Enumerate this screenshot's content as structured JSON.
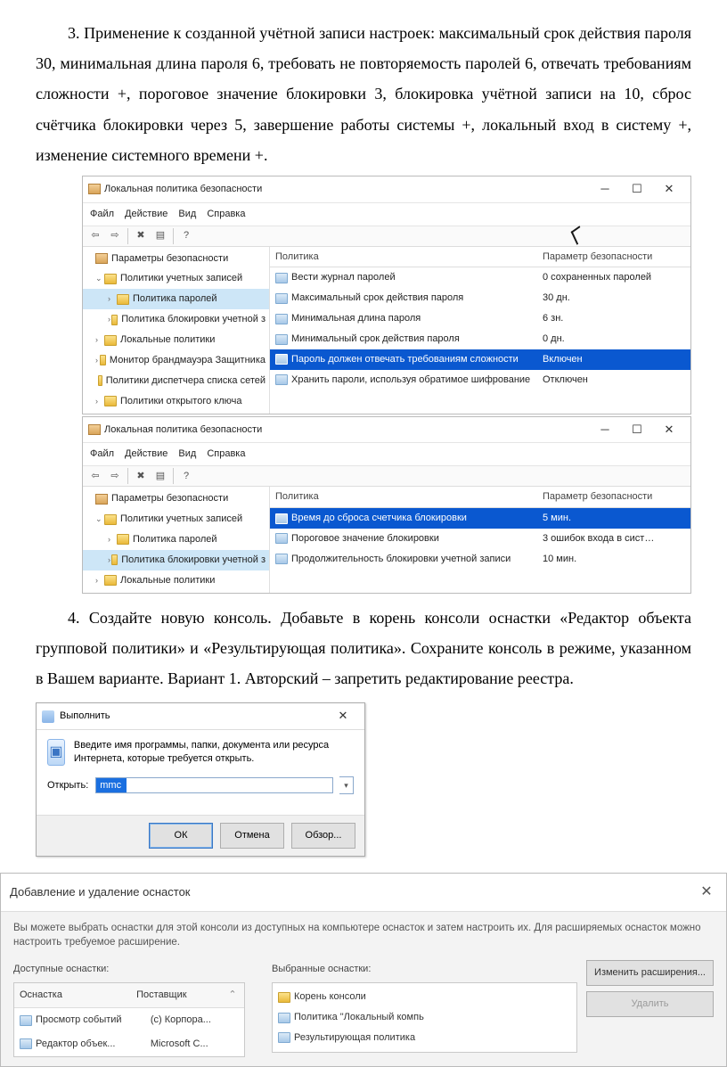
{
  "para3": "3. Применение к созданной учётной записи настроек: максимальный срок действия пароля 30, минимальная длина пароля 6, требовать не повторяемость паролей 6, отвечать требованиям сложности +, пороговое значение блокировки 3, блокировка учётной записи на 10, сброс счётчика блокировки через 5, завершение работы системы +, локальный вход в систему +, изменение системного времени +.",
  "para4": "4. Создайте новую консоль. Добавьте в корень консоли оснастки «Редактор объекта групповой политики» и «Результирующая политика». Сохраните консоль в режиме, указанном в Вашем варианте.  Вариант 1. Авторский – запретить редактирование реестра.",
  "secpol": {
    "title": "Локальная политика безопасности",
    "menu": [
      "Файл",
      "Действие",
      "Вид",
      "Справка"
    ],
    "tree_root": "Параметры безопасности",
    "tree_group": "Политики учетных записей",
    "tree_pw": "Политика паролей",
    "tree_lock": "Политика блокировки учетной з",
    "tree_local": "Локальные политики",
    "tree_fw": "Монитор брандмауэра Защитника",
    "tree_netlist": "Политики диспетчера списка сетей",
    "tree_pubkey": "Политики открытого ключа",
    "head_policy": "Политика",
    "head_param": "Параметр безопасности",
    "pw_rows": [
      {
        "p": "Вести журнал паролей",
        "v": "0 сохраненных паролей"
      },
      {
        "p": "Максимальный срок действия пароля",
        "v": "30 дн."
      },
      {
        "p": "Минимальная длина пароля",
        "v": "6 зн."
      },
      {
        "p": "Минимальный срок действия пароля",
        "v": "0 дн."
      },
      {
        "p": "Пароль должен отвечать требованиям сложности",
        "v": "Включен",
        "sel": true
      },
      {
        "p": "Хранить пароли, используя обратимое шифрование",
        "v": "Отключен"
      }
    ],
    "lock_rows": [
      {
        "p": "Время до сброса счетчика блокировки",
        "v": "5 мин.",
        "sel": true
      },
      {
        "p": "Пороговое значение блокировки",
        "v": "3 ошибок входа в сист…"
      },
      {
        "p": "Продолжительность блокировки учетной записи",
        "v": "10 мин."
      }
    ]
  },
  "run": {
    "title": "Выполнить",
    "msg": "Введите имя программы, папки, документа или ресурса Интернета, которые требуется открыть.",
    "open_label": "Открыть:",
    "value": "mmc",
    "ok": "ОК",
    "cancel": "Отмена",
    "browse": "Обзор..."
  },
  "snapin": {
    "title": "Добавление и удаление оснасток",
    "desc": "Вы можете выбрать оснастки для этой консоли из доступных на компьютере оснасток и затем настроить их. Для расширяемых оснасток можно настроить требуемое расширение.",
    "avail_label": "Доступные оснастки:",
    "selected_label": "Выбранные оснастки:",
    "col_snapin": "Оснастка",
    "col_vendor": "Поставщик",
    "avail": [
      {
        "n": "Просмотр событий",
        "v": "(с) Корпора..."
      },
      {
        "n": "Редактор объек...",
        "v": "Microsoft C..."
      }
    ],
    "root": "Корень консоли",
    "sel": [
      "Политика \"Локальный компь",
      "Результирующая политика"
    ],
    "btn_ext": "Изменить расширения...",
    "btn_del": "Удалить"
  }
}
